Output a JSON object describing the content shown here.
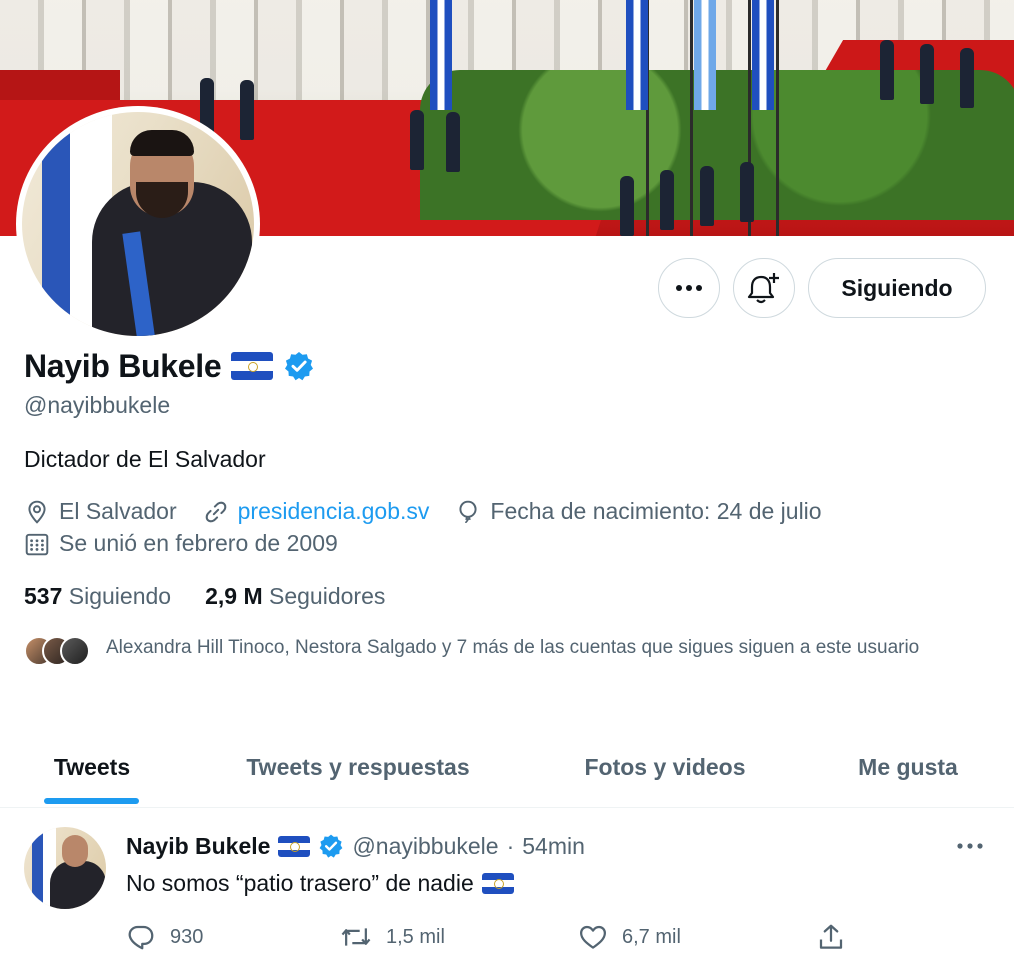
{
  "profile": {
    "name": "Nayib Bukele",
    "handle": "@nayibbukele",
    "bio": "Dictador de El Salvador",
    "location": "El Salvador",
    "website": "presidencia.gob.sv",
    "birthday": "Fecha de nacimiento: 24 de julio",
    "joined": "Se unió en febrero de 2009",
    "verified_icon": "verified-badge-icon",
    "flag_icon": "el-salvador-flag-icon"
  },
  "actions": {
    "more_icon": "more-icon",
    "notify_icon": "bell-plus-icon",
    "follow_label": "Siguiendo"
  },
  "stats": {
    "following_count": "537",
    "following_label": "Siguiendo",
    "followers_count": "2,9 M",
    "followers_label": "Seguidores"
  },
  "followed_by": {
    "text": "Alexandra Hill Tinoco, Nestora Salgado y 7 más de las cuentas que sigues siguen a este usuario"
  },
  "tabs": [
    {
      "label": "Tweets",
      "active": true
    },
    {
      "label": "Tweets y respuestas",
      "active": false
    },
    {
      "label": "Fotos y videos",
      "active": false
    },
    {
      "label": "Me gusta",
      "active": false
    }
  ],
  "tweet": {
    "author": "Nayib Bukele",
    "handle": "@nayibbukele",
    "separator": "·",
    "time": "54min",
    "text": "No somos “patio trasero” de nadie",
    "replies": "930",
    "retweets": "1,5 mil",
    "likes": "6,7 mil"
  },
  "colors": {
    "accent": "#1d9bf0",
    "text_primary": "#0f1419",
    "text_secondary": "#536471",
    "border": "#cfd9de"
  }
}
